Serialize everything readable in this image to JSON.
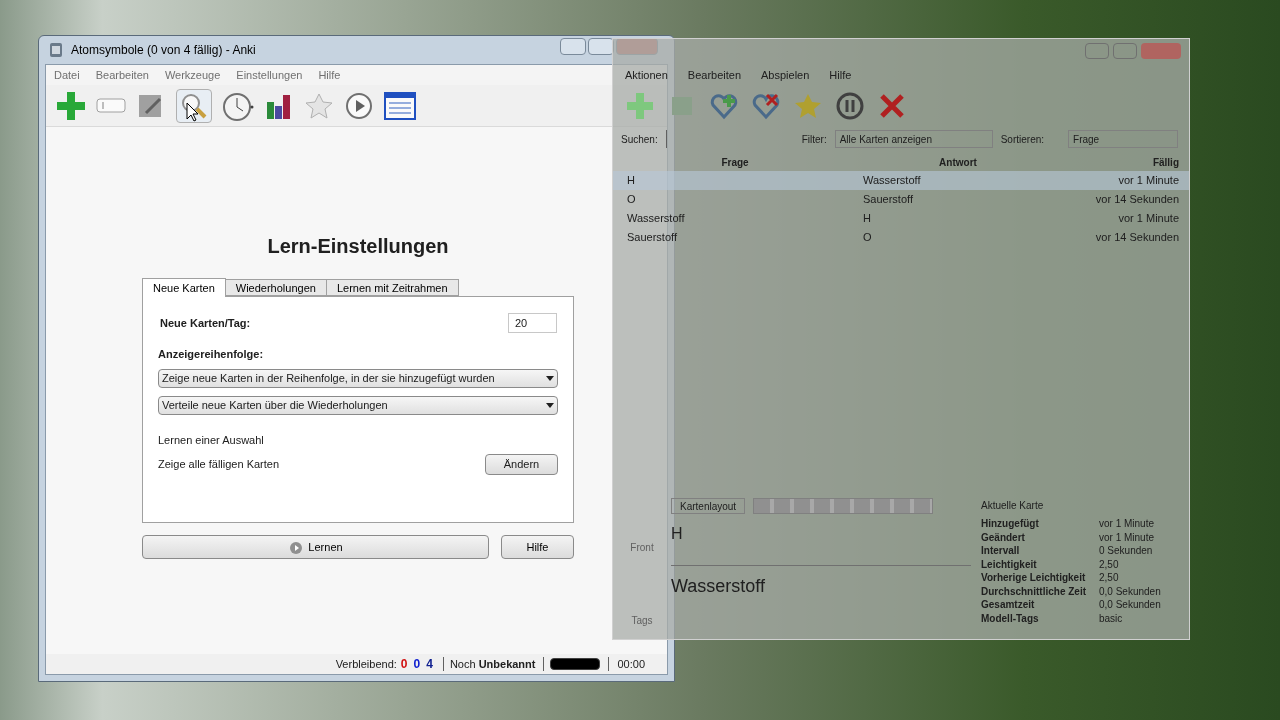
{
  "window": {
    "title": "Atomsymbole (0 von 4 fällig) - Anki"
  },
  "menu": [
    "Datei",
    "Bearbeiten",
    "Werkzeuge",
    "Einstellungen",
    "Hilfe"
  ],
  "heading": "Lern-Einstellungen",
  "tabs": [
    {
      "label": "Neue Karten",
      "selected": true
    },
    {
      "label": "Wiederholungen",
      "selected": false
    },
    {
      "label": "Lernen mit Zeitrahmen",
      "selected": false
    }
  ],
  "new_per_day": {
    "label": "Neue Karten/Tag:",
    "value": "20"
  },
  "order": {
    "label": "Anzeigereihenfolge:",
    "dropdowns": [
      "Zeige neue Karten in der Reihenfolge, in der sie hinzugefügt wurden",
      "Verteile neue Karten über die Wiederholungen"
    ]
  },
  "selection": {
    "label": "Lernen einer Auswahl",
    "value": "Zeige alle fälligen Karten",
    "button": "Ändern"
  },
  "buttons": {
    "learn": "Lernen",
    "help": "Hilfe"
  },
  "status_bar": {
    "remaining_label": "Verbleibend:",
    "counts": [
      {
        "text": "0",
        "color": "#d01010"
      },
      {
        "text": "0",
        "color": "#1020d0"
      },
      {
        "text": "4",
        "color": "#102090"
      }
    ],
    "estimate": "Noch **Unbekannt**",
    "timer": "00:00"
  },
  "browser": {
    "menu": [
      "Aktionen",
      "Bearbeiten",
      "Abspielen",
      "Hilfe"
    ],
    "search_label": "Suchen:",
    "filter_label": "Filter:",
    "filter": "Alle Karten anzeigen",
    "sort_label": "Sortieren:",
    "sort": "Frage",
    "columns": [
      "Frage",
      "Antwort",
      "Fällig"
    ],
    "rows": [
      {
        "cells": [
          "H",
          "Wasserstoff",
          "vor 1 Minute"
        ],
        "selected": true
      },
      {
        "cells": [
          "O",
          "Sauerstoff",
          "vor 14 Sekunden"
        ],
        "selected": false
      },
      {
        "cells": [
          "Wasserstoff",
          "H",
          "vor 1 Minute"
        ],
        "selected": false
      },
      {
        "cells": [
          "Sauerstoff",
          "O",
          "vor 14 Sekunden"
        ],
        "selected": false
      }
    ],
    "layout_button": "Kartenlayout",
    "front_label": "Front",
    "front_value": "H",
    "back_value": "Wasserstoff",
    "tags_label": "Tags",
    "info": {
      "title": "Aktuelle Karte",
      "rows": [
        [
          "Hinzugefügt",
          "vor 1 Minute"
        ],
        [
          "Geändert",
          "vor 1 Minute"
        ],
        [
          "Intervall",
          "0 Sekunden"
        ],
        [
          "Leichtigkeit",
          "2,50"
        ],
        [
          "Vorherige Leichtigkeit",
          "2,50"
        ],
        [
          "Durchschnittliche Zeit",
          "0,0 Sekunden"
        ],
        [
          "Gesamtzeit",
          "0,0 Sekunden"
        ],
        [
          "Modell-Tags",
          "basic"
        ]
      ]
    }
  }
}
